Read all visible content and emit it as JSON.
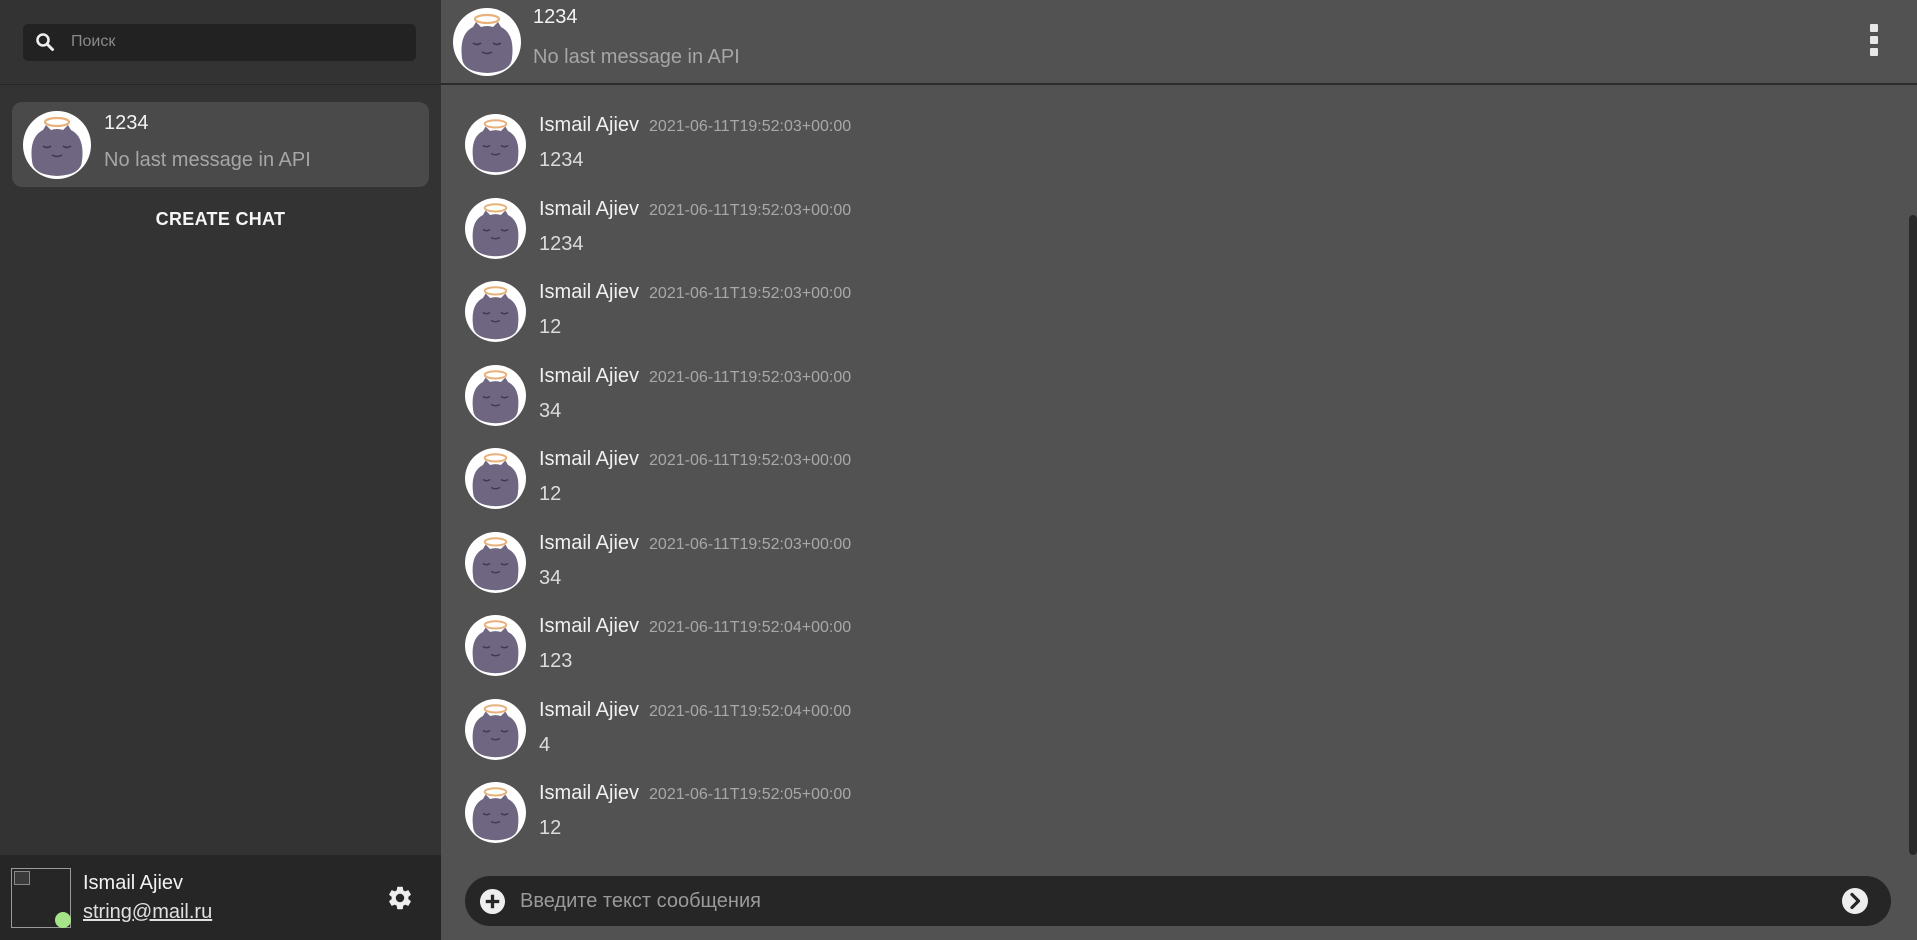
{
  "search": {
    "placeholder": "Поиск"
  },
  "chat_list": [
    {
      "title": "1234",
      "last_message": "No last message in API"
    }
  ],
  "create_chat_label": "CREATE CHAT",
  "current_user": {
    "name": "Ismail Ajiev",
    "email": "string@mail.ru",
    "online": true
  },
  "header": {
    "title": "1234",
    "subtitle": "No last message in API"
  },
  "messages": [
    {
      "author": "Ismail Ajiev",
      "time": "2021-06-11T19:52:03+00:00",
      "text": "1234"
    },
    {
      "author": "Ismail Ajiev",
      "time": "2021-06-11T19:52:03+00:00",
      "text": "1234"
    },
    {
      "author": "Ismail Ajiev",
      "time": "2021-06-11T19:52:03+00:00",
      "text": "12"
    },
    {
      "author": "Ismail Ajiev",
      "time": "2021-06-11T19:52:03+00:00",
      "text": "34"
    },
    {
      "author": "Ismail Ajiev",
      "time": "2021-06-11T19:52:03+00:00",
      "text": "12"
    },
    {
      "author": "Ismail Ajiev",
      "time": "2021-06-11T19:52:03+00:00",
      "text": "34"
    },
    {
      "author": "Ismail Ajiev",
      "time": "2021-06-11T19:52:04+00:00",
      "text": "123"
    },
    {
      "author": "Ismail Ajiev",
      "time": "2021-06-11T19:52:04+00:00",
      "text": "4"
    },
    {
      "author": "Ismail Ajiev",
      "time": "2021-06-11T19:52:05+00:00",
      "text": "12"
    }
  ],
  "composer": {
    "placeholder": "Введите текст сообщения"
  },
  "icons": {
    "search": "search-icon",
    "settings": "gear-icon",
    "menu": "kebab-menu-icon",
    "attach": "plus-circle-icon",
    "send": "send-arrow-icon"
  },
  "colors": {
    "sidebar": "#333333",
    "main": "#525252",
    "active_chat": "#4a4a4a",
    "online": "#a6e48a"
  }
}
